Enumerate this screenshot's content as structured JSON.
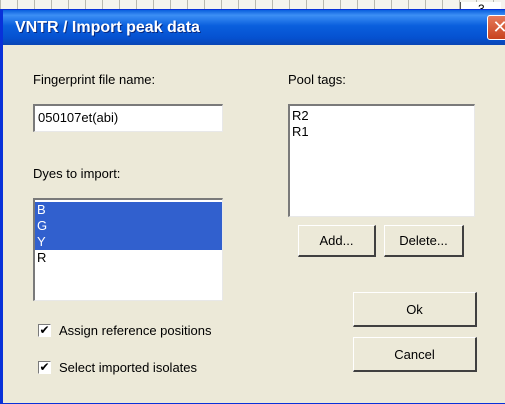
{
  "window": {
    "title": "VNTR / Import peak data",
    "close_symbol": "✕",
    "background_number": "3"
  },
  "fingerprint": {
    "label": "Fingerprint file name:",
    "value": "050107et(abi)"
  },
  "pool_tags": {
    "label": "Pool tags:",
    "items": [
      "R2",
      "R1"
    ]
  },
  "dyes": {
    "label": "Dyes to import:",
    "items": [
      {
        "label": "B",
        "selected": true
      },
      {
        "label": "G",
        "selected": true
      },
      {
        "label": "Y",
        "selected": true
      },
      {
        "label": "R",
        "selected": false
      }
    ]
  },
  "buttons": {
    "add": "Add...",
    "delete": "Delete...",
    "ok": "Ok",
    "cancel": "Cancel"
  },
  "options": {
    "assign_reference": {
      "label": "Assign reference positions",
      "checked": true
    },
    "select_imported": {
      "label": "Select imported isolates",
      "checked": true
    }
  },
  "colors": {
    "titlebar": "#0a5fdd",
    "selection": "#3160ce",
    "dialog_bg": "#ece9d8",
    "close_button": "#c8421e"
  }
}
